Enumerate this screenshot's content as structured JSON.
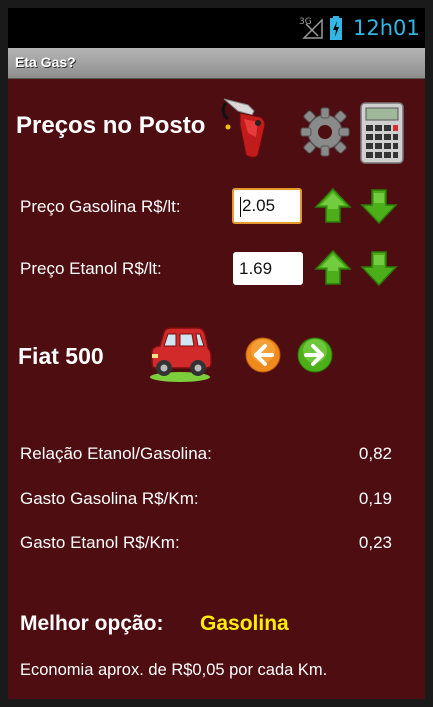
{
  "status_bar": {
    "network": "3G",
    "time": "12h01"
  },
  "app": {
    "title": "Eta Gas?"
  },
  "prices": {
    "heading": "Preços no Posto",
    "gasoline_label": "Preço Gasolina R$/lt:",
    "gasoline_value": "2.05",
    "ethanol_label": "Preço Etanol R$/lt:",
    "ethanol_value": "1.69"
  },
  "car": {
    "name": "Fiat 500"
  },
  "results": {
    "ratio_label": "Relação Etanol/Gasolina:",
    "ratio_value": "0,82",
    "gas_cost_label": "Gasto Gasolina R$/Km:",
    "gas_cost_value": "0,19",
    "eth_cost_label": "Gasto Etanol R$/Km:",
    "eth_cost_value": "0,23"
  },
  "best": {
    "label": "Melhor opção:",
    "value": "Gasolina",
    "economy": "Economia aprox. de R$0,05 por cada Km."
  },
  "colors": {
    "background": "#4e0d10",
    "accent_time": "#33b5e5",
    "best_value": "#ffee00",
    "arrow_green": "#4caf1a",
    "nav_orange": "#f08a1c"
  }
}
